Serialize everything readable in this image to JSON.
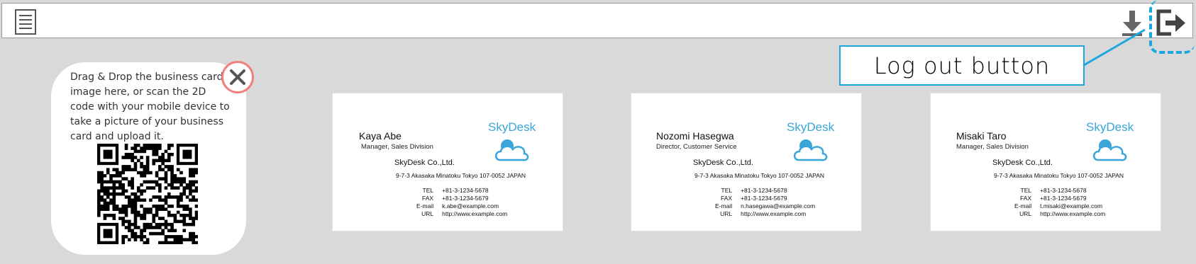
{
  "toolbar": {
    "menu_icon": "hamburger-document-icon",
    "download_icon": "download-icon",
    "logout_icon": "logout-icon"
  },
  "callout": {
    "label": "Log out button",
    "color": "#1aa7e0"
  },
  "upload": {
    "instructions": "Drag & Drop the business card image here, or scan the 2D code with your mobile device to take a picture of your business card and upload it.",
    "close_icon": "close-icon",
    "qr_icon": "qr-code-icon"
  },
  "cards": [
    {
      "brand": "SkyDesk",
      "name": "Kaya Abe",
      "title": "Manager, Sales Division",
      "company": "SkyDesk Co.,Ltd.",
      "address": "9-7-3  Akasaka Minatoku Tokyo 107-0052 JAPAN",
      "tel_label": "TEL",
      "tel": "+81-3-1234-5678",
      "fax_label": "FAX",
      "fax": "+81-3-1234-5679",
      "email_label": "E-mail",
      "email": "k.abe@example.com",
      "url_label": "URL",
      "url": "http://www.example.com"
    },
    {
      "brand": "SkyDesk",
      "name": "Nozomi Hasegwa",
      "title": "Director, Customer Service",
      "company": "SkyDesk Co.,Ltd.",
      "address": "9-7-3  Akasaka Minatoku Tokyo 107-0052 JAPAN",
      "tel_label": "TEL",
      "tel": "+81-3-1234-5678",
      "fax_label": "FAX",
      "fax": "+81-3-1234-5679",
      "email_label": "E-mail",
      "email": "n.hasegawa@example.com",
      "url_label": "URL",
      "url": "http://www.example.com"
    },
    {
      "brand": "SkyDesk",
      "name": "Misaki Taro",
      "title": "Manager, Sales Division",
      "company": "SkyDesk Co.,Ltd.",
      "address": "9-7-3  Akasaka Minatoku Tokyo 107-0052 JAPAN",
      "tel_label": "TEL",
      "tel": "+81-3-1234-5678",
      "fax_label": "FAX",
      "fax": "+81-3-1234-5679",
      "email_label": "E-mail",
      "email": "t.misaki@example.com",
      "url_label": "URL",
      "url": "http://www.example.com"
    }
  ]
}
